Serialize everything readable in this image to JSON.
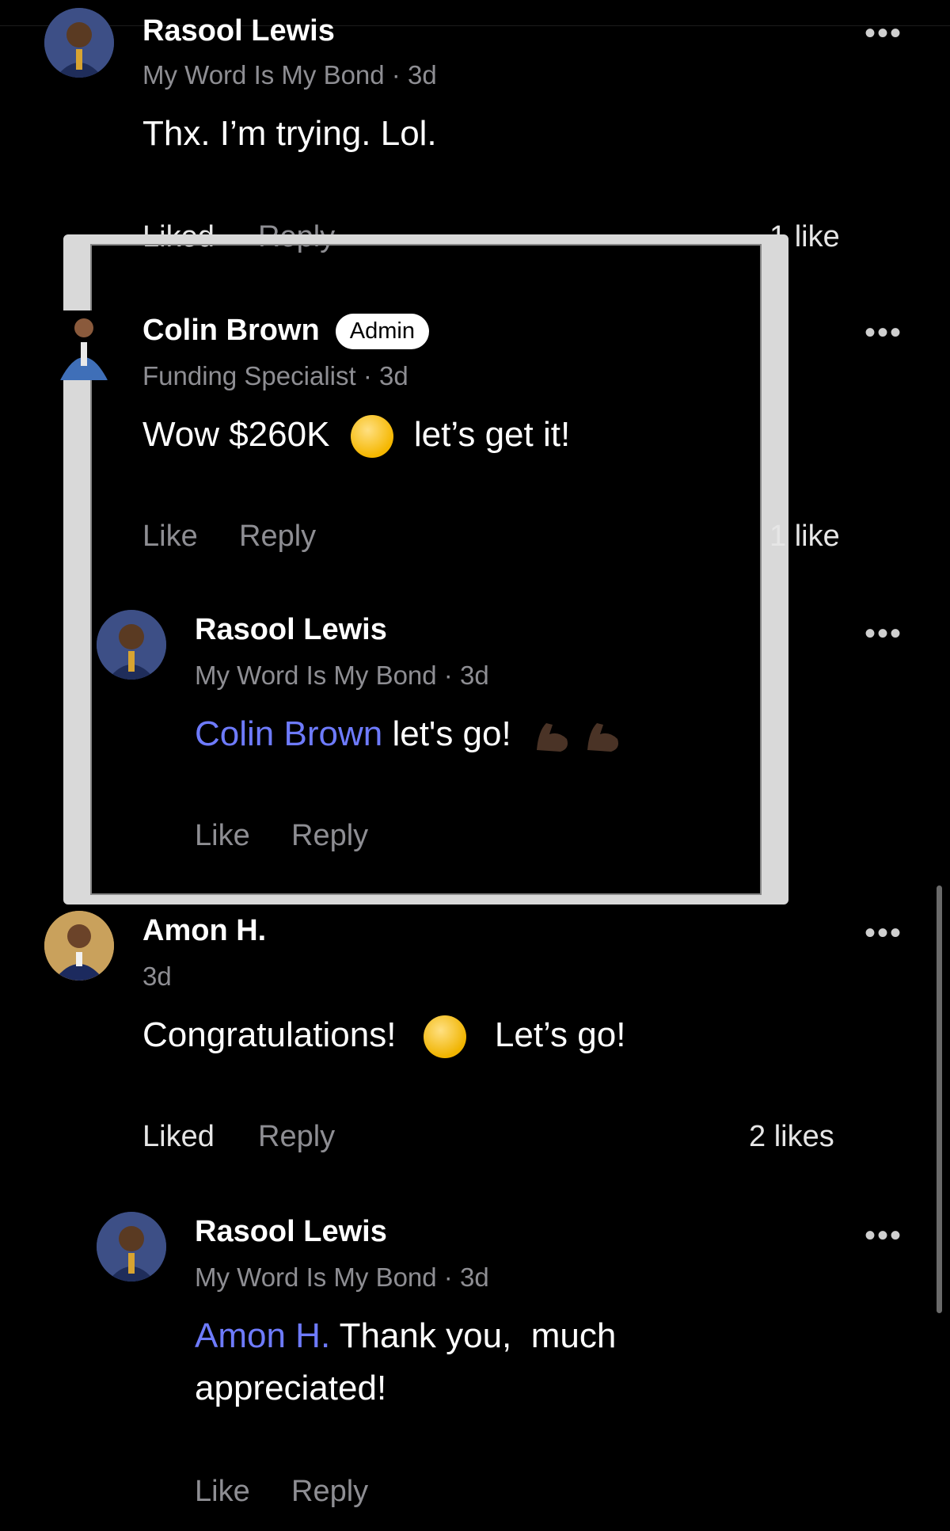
{
  "comments": [
    {
      "name": "Rasool Lewis",
      "meta": "My Word Is My Bond · 3d",
      "text": "Thx. I’m trying. Lol.",
      "actions": {
        "like": "Liked",
        "reply": "Reply"
      },
      "likes": "1 like"
    },
    {
      "name": "Colin Brown",
      "badge": "Admin",
      "meta": "Funding Specialist · 3d",
      "text_before": "Wow $260K",
      "emoji": "face-with-steam-emoji",
      "text_after": "let’s get it!",
      "actions": {
        "like": "Like",
        "reply": "Reply"
      },
      "likes": "1 like"
    },
    {
      "name": "Rasool Lewis",
      "meta": "My Word Is My Bond · 3d",
      "mention": "Colin Brown",
      "text": " let's go!",
      "actions": {
        "like": "Like",
        "reply": "Reply"
      }
    },
    {
      "name": "Amon H.",
      "meta": "3d",
      "text_before": "Congratulations!",
      "emoji": "money-mouth-emoji",
      "text_after": "Let’s go!",
      "actions": {
        "like": "Liked",
        "reply": "Reply"
      },
      "likes": "2 likes"
    },
    {
      "name": "Rasool Lewis",
      "meta": "My Word Is My Bond · 3d",
      "mention": "Amon H.",
      "text_line1": " Thank you,  much",
      "text_line2": "appreciated!",
      "actions": {
        "like": "Like",
        "reply": "Reply"
      }
    }
  ],
  "more_glyph": "•••",
  "colors": {
    "background": "#000000",
    "mention": "#6e7bff",
    "muted": "#8e8e93",
    "frame": "#d9d9d9"
  }
}
